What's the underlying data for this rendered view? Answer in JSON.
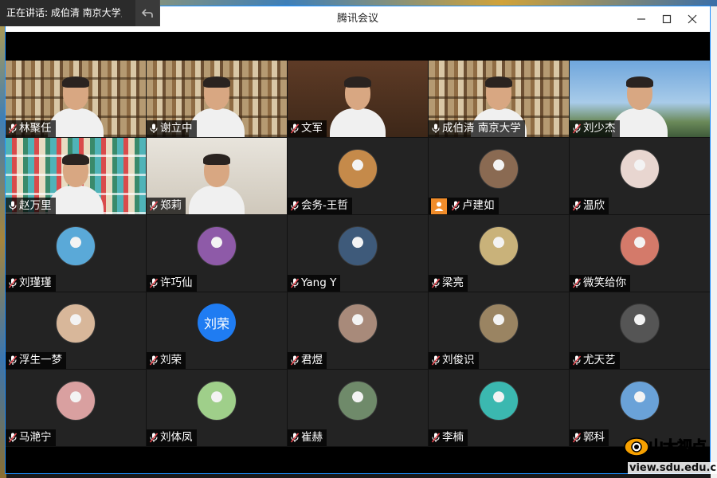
{
  "window": {
    "title": "腾讯会议"
  },
  "speaking": {
    "text": "正在讲话: 成伯清 南京大学;"
  },
  "participants": [
    {
      "name": "林聚任",
      "mic": "muted",
      "tile": "video",
      "bg": "shelf"
    },
    {
      "name": "谢立中",
      "mic": "on",
      "tile": "video",
      "bg": "shelf"
    },
    {
      "name": "文军",
      "mic": "muted",
      "tile": "video",
      "bg": "dark"
    },
    {
      "name": "成伯清 南京大学",
      "mic": "on",
      "tile": "video",
      "bg": "shelf",
      "active": true
    },
    {
      "name": "刘少杰",
      "mic": "muted",
      "tile": "video",
      "bg": "sky"
    },
    {
      "name": "赵万里",
      "mic": "on",
      "tile": "video",
      "bg": "colorshelf"
    },
    {
      "name": "郑莉",
      "mic": "muted",
      "tile": "video",
      "bg": "wall"
    },
    {
      "name": "会务-王哲",
      "mic": "muted",
      "tile": "avatar",
      "avatar_color": "#c58a4a"
    },
    {
      "name": "卢建如",
      "mic": "muted",
      "tile": "avatar",
      "avatar_color": "#8a6a52",
      "host": true
    },
    {
      "name": "温欣",
      "mic": "muted",
      "tile": "avatar",
      "avatar_color": "#e8d6d0"
    },
    {
      "name": "刘瑾瑾",
      "mic": "muted",
      "tile": "avatar",
      "avatar_color": "#5aa9d8"
    },
    {
      "name": "许巧仙",
      "mic": "muted",
      "tile": "avatar",
      "avatar_color": "#8e5aa8"
    },
    {
      "name": "Yang Y",
      "mic": "muted",
      "tile": "avatar",
      "avatar_color": "#3e5a7a"
    },
    {
      "name": "梁亮",
      "mic": "muted",
      "tile": "avatar",
      "avatar_color": "#c9b27a"
    },
    {
      "name": "微笑给你",
      "mic": "muted",
      "tile": "avatar",
      "avatar_color": "#d47a6a"
    },
    {
      "name": "浮生一梦",
      "mic": "muted",
      "tile": "avatar",
      "avatar_color": "#d8b79a"
    },
    {
      "name": "刘荣",
      "mic": "muted",
      "tile": "text",
      "avatar_text": "刘荣",
      "avatar_color": "#1f7cf2"
    },
    {
      "name": "君煜",
      "mic": "muted",
      "tile": "avatar",
      "avatar_color": "#a88a7a"
    },
    {
      "name": "刘俊识",
      "mic": "muted",
      "tile": "avatar",
      "avatar_color": "#9a8462"
    },
    {
      "name": "尤天艺",
      "mic": "muted",
      "tile": "avatar",
      "avatar_color": "#555555"
    },
    {
      "name": "马滟宁",
      "mic": "muted",
      "tile": "avatar",
      "avatar_color": "#d9a0a0"
    },
    {
      "name": "刘体凤",
      "mic": "muted",
      "tile": "avatar",
      "avatar_color": "#9fcf8a"
    },
    {
      "name": "崔赫",
      "mic": "muted",
      "tile": "avatar",
      "avatar_color": "#6f8a6a"
    },
    {
      "name": "李楠",
      "mic": "muted",
      "tile": "avatar",
      "avatar_color": "#3bb8b0"
    },
    {
      "name": "郭科",
      "mic": "muted",
      "tile": "avatar",
      "avatar_color": "#6aa2d8"
    }
  ],
  "watermark": {
    "name": "山大视点",
    "url": "view.sdu.edu.cn"
  },
  "colors": {
    "active_border": "#3cc47c",
    "mic_muted": "#e0464e",
    "mic_on": "#ffffff",
    "host_badge": "#f08c2a"
  }
}
